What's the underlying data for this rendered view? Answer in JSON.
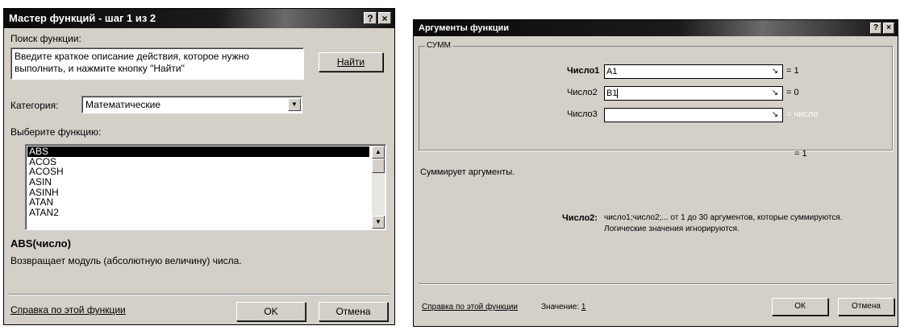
{
  "dialog1": {
    "title": "Мастер функций - шаг 1 из 2",
    "help_glyph": "?",
    "close_glyph": "×",
    "search_label": "Поиск функции:",
    "search_text": "Введите краткое описание действия, которое нужно выполнить, и нажмите кнопку \"Найти\"",
    "find_button": "Найти",
    "category_label": "Категория:",
    "category_value": "Математические",
    "select_label": "Выберите функцию:",
    "functions": [
      "ABS",
      "ACOS",
      "ACOSH",
      "ASIN",
      "ASINH",
      "ATAN",
      "ATAN2"
    ],
    "signature": "ABS(число)",
    "description": "Возвращает модуль (абсолютную величину) числа.",
    "help_link": "Справка по этой функции",
    "ok_button": "OK",
    "cancel_button": "Отмена"
  },
  "dialog2": {
    "title": "Аргументы функции",
    "help_glyph": "?",
    "close_glyph": "×",
    "group_label": "СУММ",
    "args": [
      {
        "label": "Число1",
        "value": "A1",
        "result": "= 1"
      },
      {
        "label": "Число2",
        "value": "B1",
        "result": "= 0"
      },
      {
        "label": "Число3",
        "value": "",
        "result": "= число"
      }
    ],
    "total_result": "= 1",
    "description": "Суммирует аргументы.",
    "arg_help_label": "Число2:",
    "arg_help_line1": "число1;число2;... от 1 до 30 аргументов, которые суммируются.",
    "arg_help_line2": "Логические значения игнорируются.",
    "help_link": "Справка по этой функции",
    "value_label": "Значение:",
    "value": "1",
    "ok_button": "ОК",
    "cancel_button": "Отмена"
  }
}
